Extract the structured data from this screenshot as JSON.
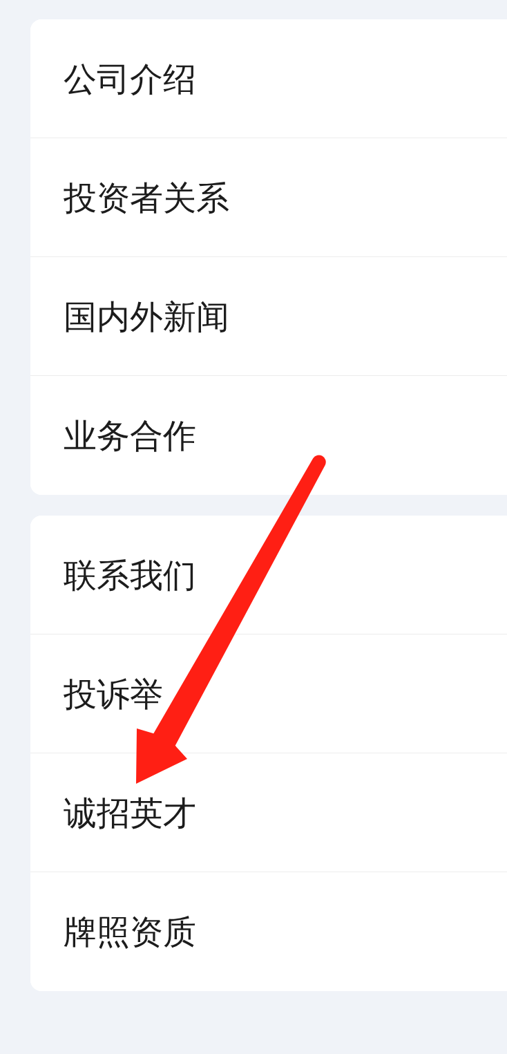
{
  "sections": [
    {
      "items": [
        "公司介绍",
        "投资者关系",
        "国内外新闻",
        "业务合作"
      ]
    },
    {
      "items": [
        "联系我们",
        "投诉举",
        "诚招英才",
        "牌照资质"
      ]
    }
  ]
}
